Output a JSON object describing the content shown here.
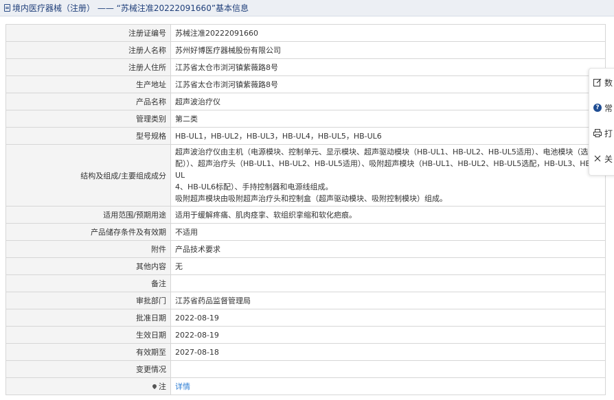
{
  "header": {
    "title": "境内医疗器械（注册） —— “苏械注准20222091660”基本信息"
  },
  "rows": [
    {
      "label": "注册证编号",
      "value": "苏械注准20222091660"
    },
    {
      "label": "注册人名称",
      "value": "苏州好博医疗器械股份有限公司"
    },
    {
      "label": "注册人住所",
      "value": "江苏省太仓市浏河镇紫薇路8号"
    },
    {
      "label": "生产地址",
      "value": "江苏省太仓市浏河镇紫薇路8号"
    },
    {
      "label": "产品名称",
      "value": "超声波治疗仪"
    },
    {
      "label": "管理类别",
      "value": "第二类"
    },
    {
      "label": "型号规格",
      "value": "HB-UL1，HB-UL2，HB-UL3，HB-UL4，HB-UL5，HB-UL6"
    },
    {
      "label": "结构及组成/主要组成成分",
      "lines": [
        "超声波治疗仪由主机（电源模块、控制单元、显示模块、超声驱动模块（HB-UL1、HB-UL2、HB-UL5适用）、电池模块（选",
        "配））、超声治疗头（HB-UL1、HB-UL2、HB-UL5适用）、吸附超声模块（HB-UL1、HB-UL2、HB-UL5选配，HB-UL3、HB-UL",
        "4、HB-UL6标配）、手持控制器和电源线组成。",
        "吸附超声模块由吸附超声治疗头和控制盒（超声驱动模块、吸附控制模块）组成。"
      ]
    },
    {
      "label": "适用范围/预期用途",
      "value": "适用于缓解疼痛、肌肉痉挛、软组织挛缩和软化疤痕。"
    },
    {
      "label": "产品储存条件及有效期",
      "value": "不适用"
    },
    {
      "label": "附件",
      "value": "产品技术要求"
    },
    {
      "label": "其他内容",
      "value": "无"
    },
    {
      "label": "备注",
      "value": ""
    },
    {
      "label": "审批部门",
      "value": "江苏省药品监督管理局"
    },
    {
      "label": "批准日期",
      "value": "2022-08-19"
    },
    {
      "label": "生效日期",
      "value": "2022-08-19"
    },
    {
      "label": "有效期至",
      "value": "2027-08-18"
    },
    {
      "label": "变更情况",
      "value": ""
    }
  ],
  "note_row": {
    "label": "注",
    "icon": "pin-icon",
    "link_text": "详情",
    "link_color": "#2b7cd3"
  },
  "floater": {
    "items": [
      {
        "label": "数",
        "icon": "edit-icon"
      },
      {
        "label": "常",
        "icon": "help-icon",
        "icon_text": "?"
      },
      {
        "label": "打",
        "icon": "print-icon"
      },
      {
        "label": "关",
        "icon": "close-icon"
      }
    ]
  },
  "colors": {
    "header_bg": "#eceff4",
    "header_text": "#1f3f7a",
    "label_bg": "#f4f4f4",
    "border": "#d6d6d6",
    "link": "#2b7cd3"
  }
}
